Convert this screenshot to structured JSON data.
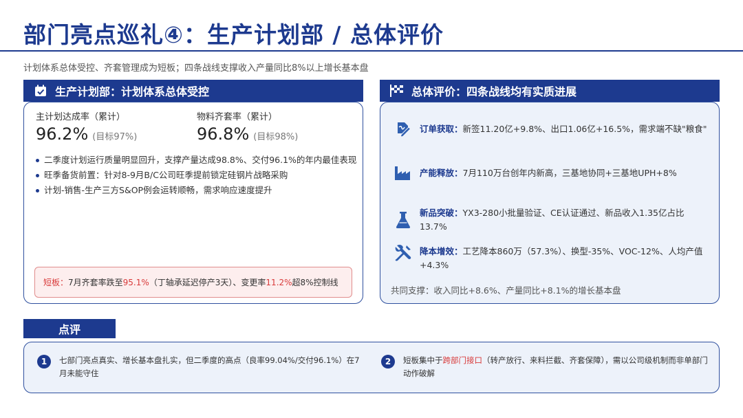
{
  "header": {
    "title": "部门亮点巡礼④：生产计划部 / 总体评价",
    "subtitle": "计划体系总体受控、齐套管理成为短板；四条战线支撑收入产量同比8%以上增长基本盘"
  },
  "left": {
    "banner": "生产计划部：计划体系总体受控",
    "icon": "calendar-check-icon",
    "metrics": [
      {
        "label": "主计划达成率（累计）",
        "value": "96.2%",
        "target": "(目标97%)"
      },
      {
        "label": "物料齐套率（累计）",
        "value": "96.8%",
        "target": "(目标98%)"
      }
    ],
    "bullets": [
      "二季度计划运行质量明显回升，支撑产量达成98.8%、交付96.1%的年内最佳表现",
      "旺季备货前置：针对8-9月B/C公司旺季提前锁定硅钢片战略采购",
      "计划-销售-生产三方S&OP例会运转顺畅，需求响应速度提升"
    ],
    "warning": {
      "label": "短板：",
      "part1": "7月齐套率跌至",
      "value1": "95.1%",
      "part2": "（丁轴承延迟停产3天）、变更率",
      "value2": "11.2%",
      "part3": "超8%控制线"
    }
  },
  "right": {
    "banner": "总体评价：四条战线均有实质进展",
    "icon": "checkered-flag-icon",
    "rows": [
      {
        "icon": "signature-pen-icon",
        "label": "订单获取：",
        "text": "新签11.20亿+9.8%、出口1.06亿+16.5%，需求端不缺\"粮食\""
      },
      {
        "icon": "factory-icon",
        "label": "产能释放：",
        "text": "7月110万台创年内新高，三基地协同+三基地UPH+8%"
      },
      {
        "icon": "flask-icon",
        "label": "新品突破：",
        "text": "YX3-280小批量验证、CE认证通过、新品收入1.35亿占比13.7%"
      },
      {
        "icon": "tools-icon",
        "label": "降本增效：",
        "text": "工艺降本860万（57.3%）、换型-35%、VOC-12%、人均产值+4.3%"
      }
    ],
    "support": "共同支撑：收入同比+8.6%、产量同比+8.1%的增长基本盘"
  },
  "review": {
    "tab": "点评",
    "items": [
      {
        "num": "1",
        "text": "七部门亮点真实、增长基本盘扎实，但二季度的高点（良率99.04%/交付96.1%）在7月未能守住"
      },
      {
        "num": "2",
        "text_a": "短板集中于",
        "highlight": "跨部门接口",
        "text_b": "（转产放行、来料拦截、齐套保障），需以公司级机制而非单部门动作破解"
      }
    ]
  },
  "colors": {
    "brand": "#1d3a8f",
    "warn": "#d83a3a",
    "panel_bg": "#edf2fa"
  }
}
